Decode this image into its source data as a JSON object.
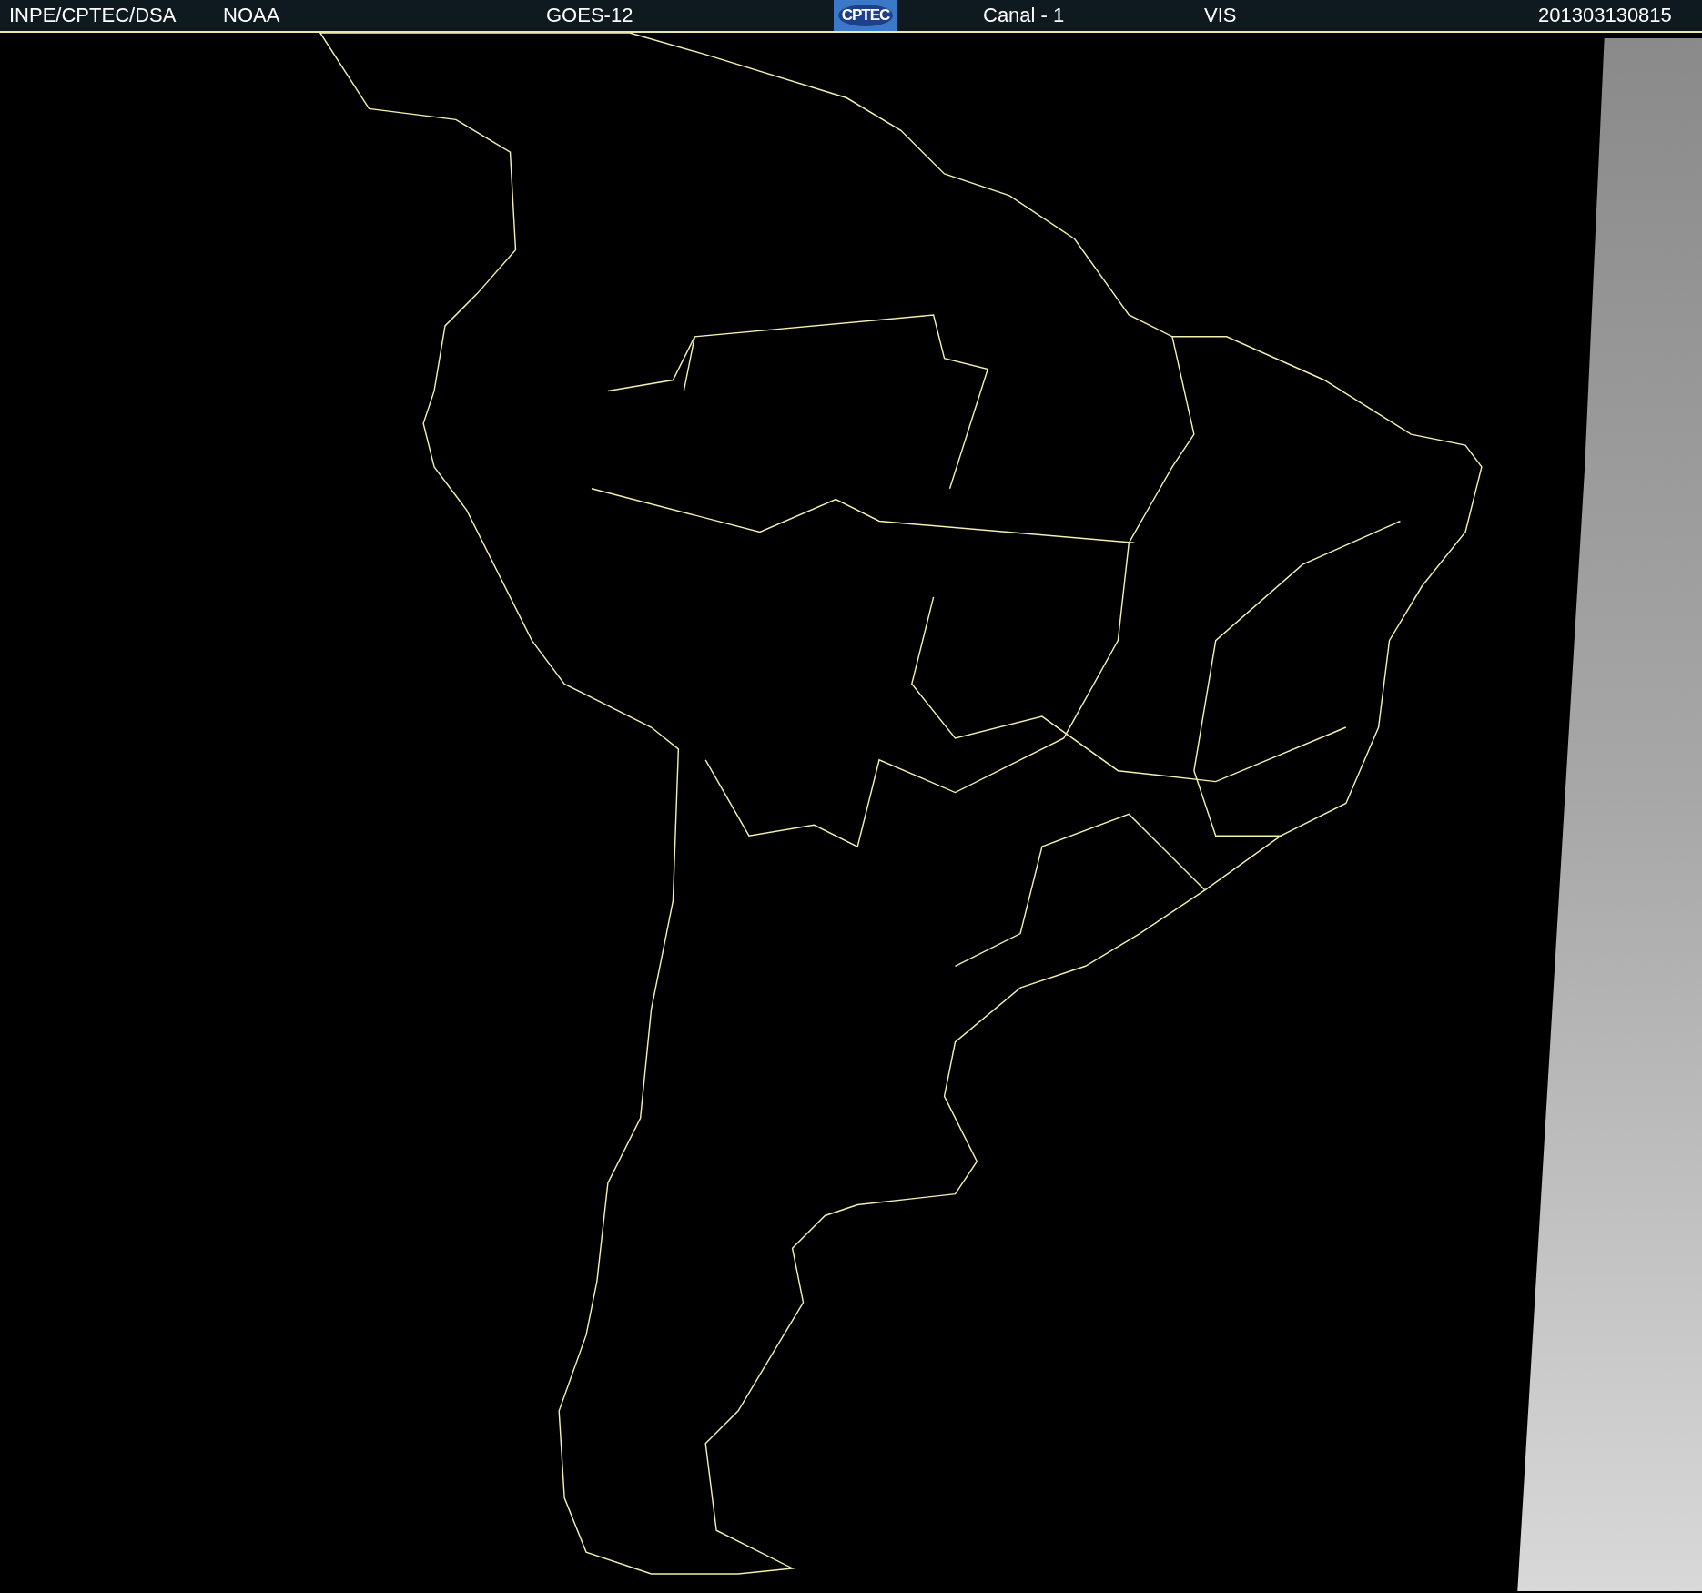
{
  "header": {
    "items": [
      {
        "kind": "text",
        "text": "INPE/CPTEC/DSA"
      },
      {
        "kind": "text",
        "text": "NOAA"
      },
      {
        "kind": "text",
        "text": "GOES-12"
      },
      {
        "kind": "logo",
        "text": "CPTEC"
      },
      {
        "kind": "text",
        "text": "Canal - 1"
      },
      {
        "kind": "text",
        "text": "VIS"
      },
      {
        "kind": "text",
        "text": "201303130815"
      }
    ]
  }
}
